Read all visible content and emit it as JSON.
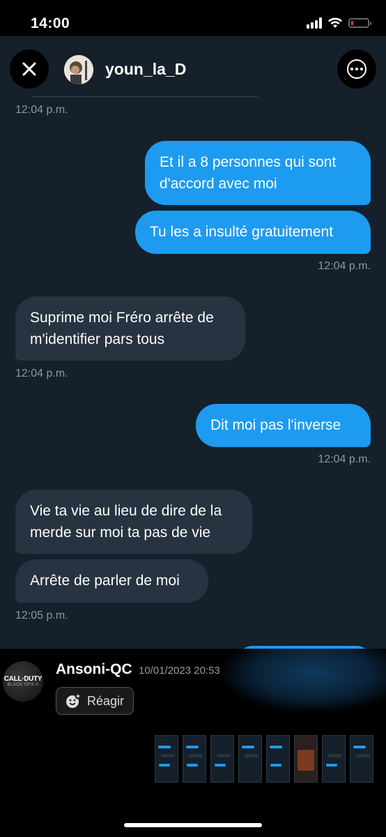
{
  "status_bar": {
    "time": "14:00",
    "battery_level": 0.15,
    "battery_color": "#ff3b30"
  },
  "header": {
    "username": "youn_la_D",
    "close_icon": "close-icon",
    "more_icon": "more-icon"
  },
  "messages": {
    "t0": "12:04 p.m.",
    "m1": "Et il a 8 personnes qui sont d'accord avec moi",
    "m2": "Tu les a insulté gratuitement",
    "t1": "12:04 p.m.",
    "m3": "Suprime moi Fréro arrête de m'identifier pars tous",
    "t2": "12:04 p.m.",
    "m4": "Dit moi pas l'inverse",
    "t3": "12:04 p.m.",
    "m5": "Vie ta vie au lieu de dire de la merde sur moi ta pas de vie",
    "m6": "Arrête de parler de moi",
    "t4": "12:05 p.m."
  },
  "notification": {
    "avatar_title": "CALL·DUTY",
    "avatar_subtitle": "BLACK OPS II",
    "name": "Ansoni-QC",
    "date": "10/01/2023 20:53",
    "react_label": "Réagir"
  },
  "colors": {
    "outgoing_bubble": "#1d9bf0",
    "incoming_bubble": "#273340",
    "chat_background": "#15202b",
    "timestamp": "#8b98a5"
  }
}
